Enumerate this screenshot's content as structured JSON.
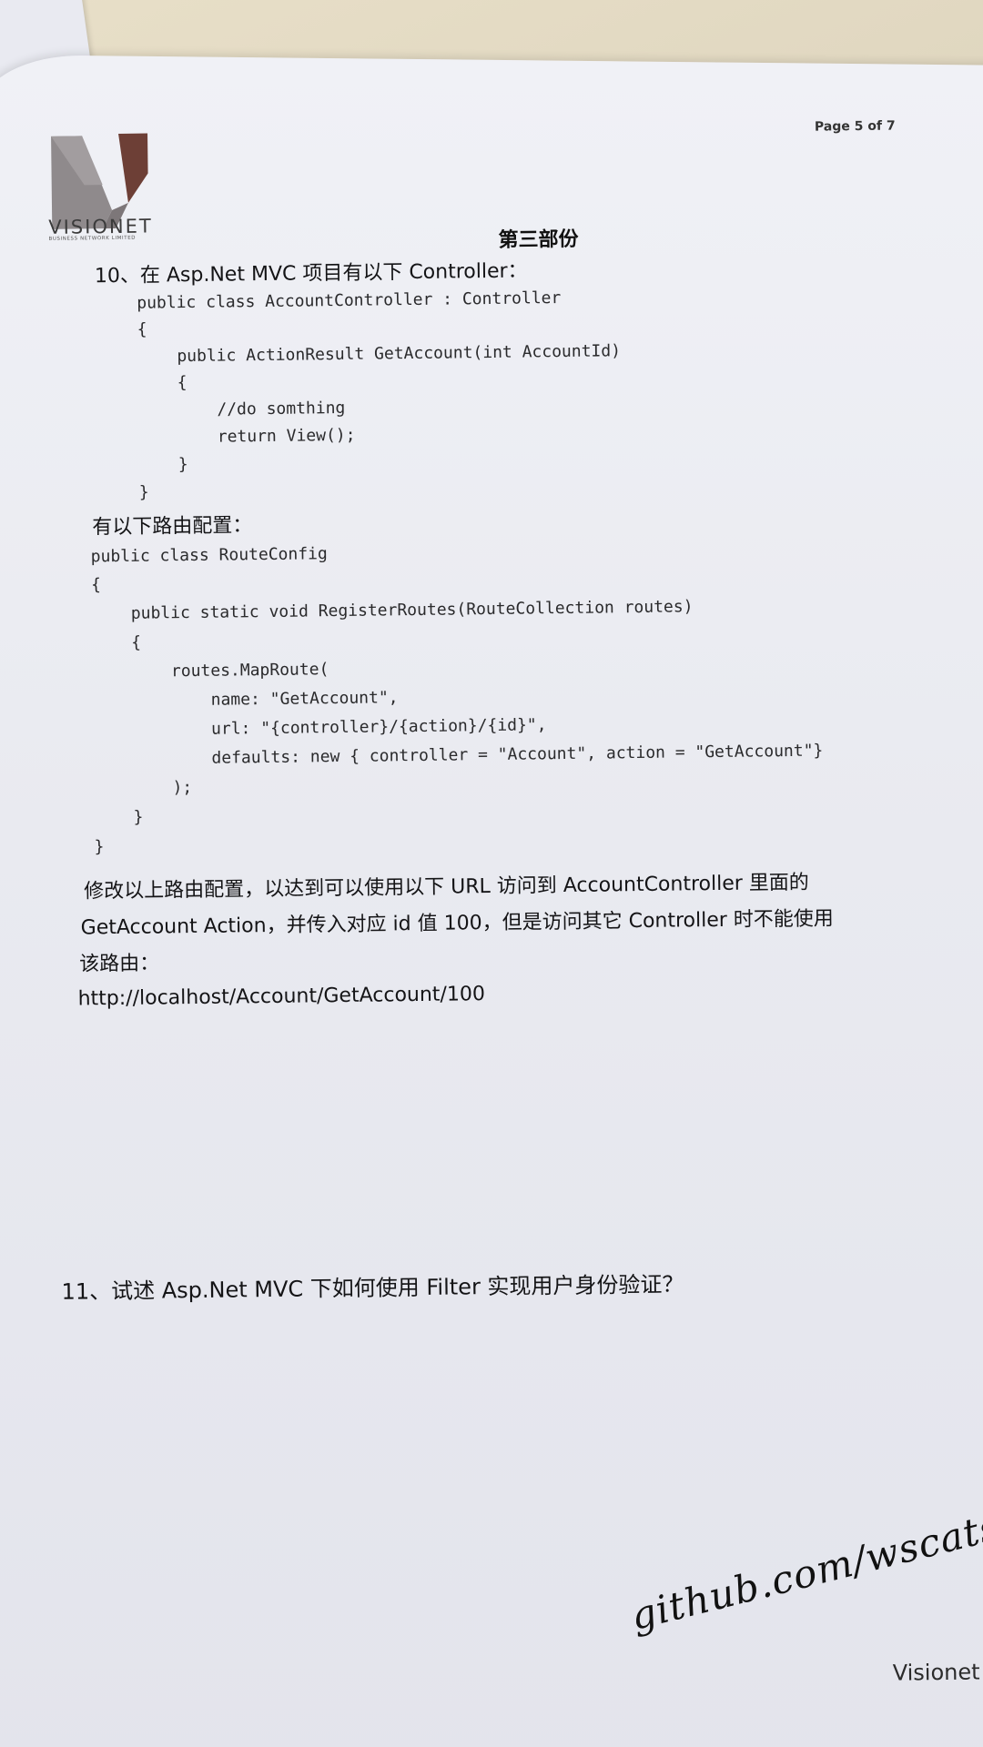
{
  "header": {
    "logo_text": "VISIONET",
    "logo_subtext": "BUSINESS NETWORK LIMITED",
    "page_number": "Page 5 of 7"
  },
  "section_title": "第三部份",
  "question10": {
    "intro": "10、在 Asp.Net MVC 项目有以下 Controller：",
    "controller_code": [
      "public class AccountController : Controller",
      "{",
      "    public ActionResult GetAccount(int AccountId)",
      "    {",
      "        //do somthing",
      "        return View();",
      "    }",
      "}"
    ],
    "route_intro": "有以下路由配置：",
    "route_code": [
      "public class RouteConfig",
      "{",
      "    public static void RegisterRoutes(RouteCollection routes)",
      "    {",
      "        routes.MapRoute(",
      "            name: \"GetAccount\",",
      "            url: \"{controller}/{action}/{id}\",",
      "            defaults: new { controller = \"Account\", action = \"GetAccount\"}",
      "        );",
      "    }",
      "}"
    ],
    "task_lines": [
      "修改以上路由配置，以达到可以使用以下 URL 访问到 AccountController 里面的",
      "GetAccount Action，并传入对应 id 值 100，但是访问其它 Controller 时不能使用",
      "该路由："
    ],
    "url": "http://localhost/Account/GetAccount/100"
  },
  "question11": {
    "text": "11、试述 Asp.Net MVC 下如何使用 Filter 实现用户身份验证？"
  },
  "watermark": "github.com/wscats",
  "footer": "Visionet T",
  "colors": {
    "paper": "#eceef4",
    "ink": "#1c1c1f",
    "logo_gray": "#8f8a8c",
    "logo_brown": "#6d3f36"
  }
}
